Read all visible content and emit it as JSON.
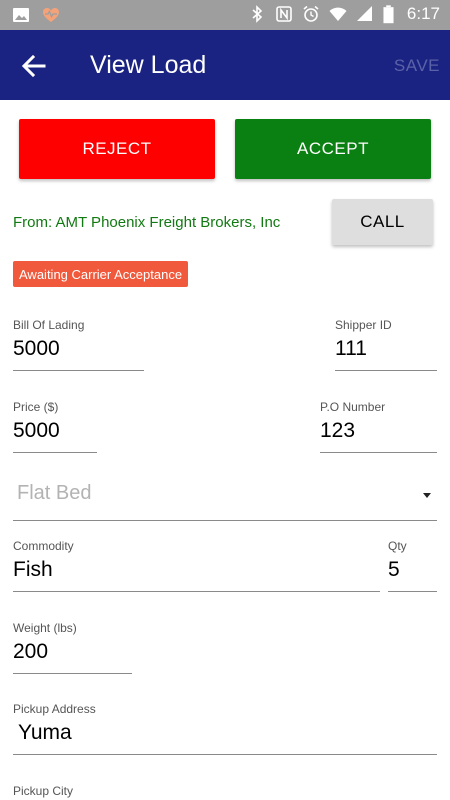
{
  "status_bar": {
    "time": "6:17",
    "icons": [
      "image-icon",
      "heart-pulse-icon",
      "bluetooth-icon",
      "nfc-icon",
      "alarm-icon",
      "wifi-icon",
      "signal-icon",
      "battery-icon"
    ]
  },
  "app_bar": {
    "title": "View Load",
    "save_label": "SAVE",
    "back_icon": "arrow-left-icon",
    "color": "#1a2381"
  },
  "actions": {
    "reject_label": "REJECT",
    "accept_label": "ACCEPT",
    "reject_color": "#ff0000",
    "accept_color": "#098011"
  },
  "broker": {
    "from_text": "From: AMT Phoenix Freight Brokers, Inc",
    "call_label": "CALL"
  },
  "status_badge": {
    "text": "Awaiting Carrier Acceptance",
    "color": "#f0593c"
  },
  "fields": {
    "bill_of_lading": {
      "label": "Bill Of Lading",
      "value": "5000"
    },
    "shipper_id": {
      "label": "Shipper ID",
      "value": "111"
    },
    "price": {
      "label": "Price ($)",
      "value": "5000"
    },
    "po_number": {
      "label": "P.O Number",
      "value": "123"
    },
    "trailer_type": {
      "placeholder": "Flat Bed"
    },
    "commodity": {
      "label": "Commodity",
      "value": "Fish"
    },
    "qty": {
      "label": "Qty",
      "value": "5"
    },
    "weight": {
      "label": "Weight (lbs)",
      "value": "200"
    },
    "pickup_address": {
      "label": "Pickup Address",
      "value": "Yuma"
    },
    "pickup_city": {
      "label": "Pickup City",
      "value": ""
    }
  }
}
